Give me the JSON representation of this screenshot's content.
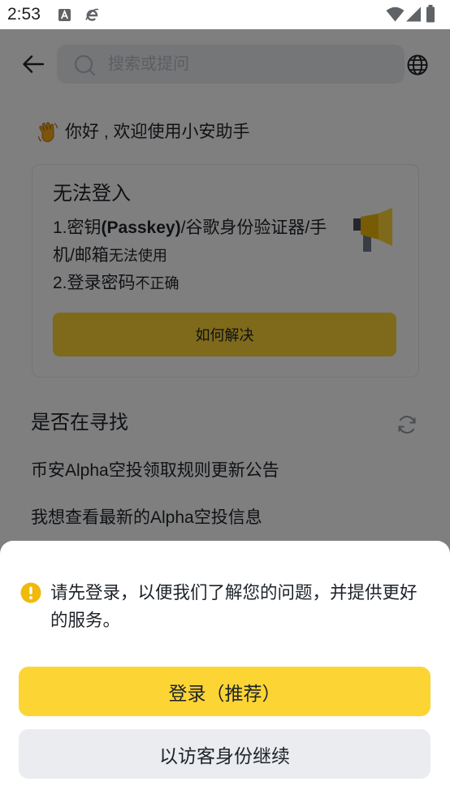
{
  "status_bar": {
    "time": "2:53",
    "icons": [
      "notification-a-icon",
      "notification-e-icon",
      "wifi-icon",
      "signal-icon",
      "battery-icon"
    ]
  },
  "header": {
    "back_icon": "back-arrow-icon",
    "search": {
      "placeholder": "搜索或提问",
      "value": "",
      "icon": "search-icon"
    },
    "language_icon": "globe-icon"
  },
  "greeting": {
    "icon": "waving-hand-icon",
    "text": "你好 , 欢迎使用小安助手"
  },
  "notice_card": {
    "title": "无法登入",
    "items": [
      {
        "prefix": "1.密钥",
        "bold": "(Passkey)",
        "main": "/谷歌身份验证器/手机/邮箱",
        "suffix": "无法使用"
      },
      {
        "prefix": "2.登录密码",
        "suffix": "不正确"
      }
    ],
    "illustration": "megaphone-illustration",
    "button_label": "如何解决"
  },
  "suggestions": {
    "title": "是否在寻找",
    "refresh_icon": "refresh-icon",
    "items": [
      "币安Alpha空投领取规则更新公告",
      "我想查看最新的Alpha空投信息"
    ]
  },
  "login_sheet": {
    "icon": "warning-icon",
    "message": "请先登录，以便我们了解您的问题，并提供更好的服务。",
    "primary_button": "登录（推荐）",
    "secondary_button": "以访客身份继续"
  },
  "colors": {
    "brand_yellow": "#FCD535",
    "warning": "#F0B90B",
    "secondary_button": "#EAECEF",
    "text_primary": "#1E2329",
    "text_placeholder": "#B7BDC6",
    "overlay": "rgba(0,0,0,0.5)"
  }
}
